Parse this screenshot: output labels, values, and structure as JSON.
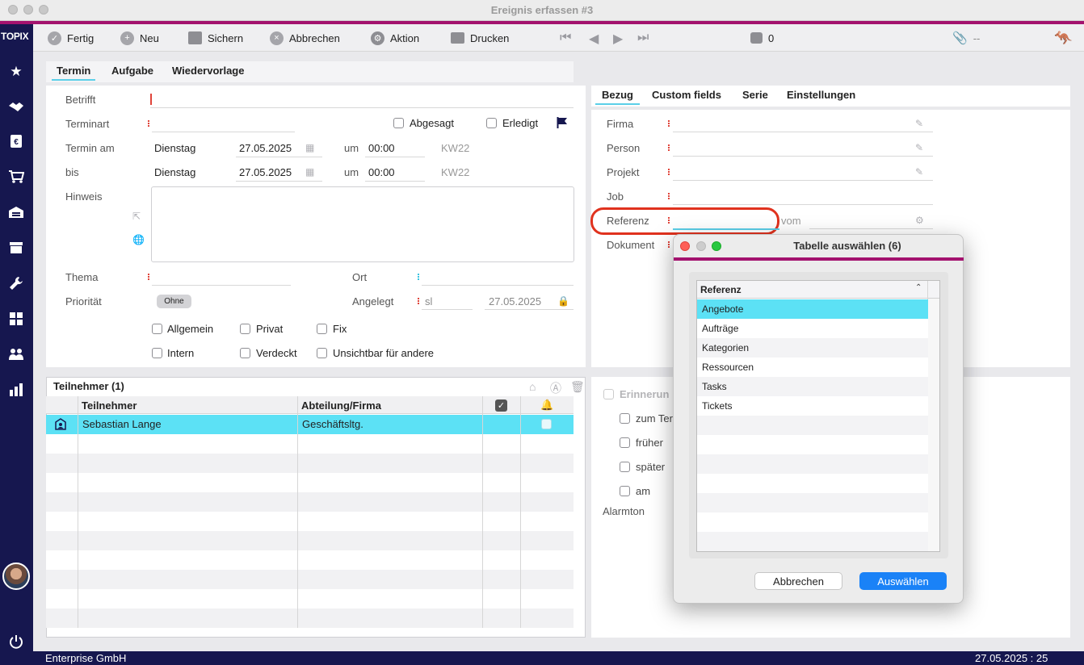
{
  "window": {
    "title": "Ereignis erfassen #3"
  },
  "sidebar": {
    "logo": "TOPIX"
  },
  "toolbar": {
    "fertig": "Fertig",
    "neu": "Neu",
    "sichern": "Sichern",
    "abbrechen": "Abbrechen",
    "aktion": "Aktion",
    "drucken": "Drucken",
    "lock_count": "0",
    "attach": "--"
  },
  "main_tabs": [
    "Termin",
    "Aufgabe",
    "Wiedervorlage"
  ],
  "form": {
    "betrifft_label": "Betrifft",
    "terminart_label": "Terminart",
    "abgesagt": "Abgesagt",
    "erledigt": "Erledigt",
    "termin_am_label": "Termin am",
    "termin_am_day": "Dienstag",
    "termin_am_date": "27.05.2025",
    "um_label": "um",
    "termin_am_time": "00:00",
    "termin_am_kw": "KW22",
    "bis_label": "bis",
    "bis_day": "Dienstag",
    "bis_date": "27.05.2025",
    "bis_um_label": "um",
    "bis_time": "00:00",
    "bis_kw": "KW22",
    "hinweis_label": "Hinweis",
    "thema_label": "Thema",
    "ort_label": "Ort",
    "prioritaet_label": "Priorität",
    "prioritaet_value": "Ohne",
    "angelegt_label": "Angelegt",
    "angelegt_user": "sl",
    "angelegt_date": "27.05.2025",
    "allgemein": "Allgemein",
    "privat": "Privat",
    "fix": "Fix",
    "intern": "Intern",
    "verdeckt": "Verdeckt",
    "unsichtbar": "Unsichtbar für andere"
  },
  "right_tabs": [
    "Bezug",
    "Custom fields",
    "Serie",
    "Einstellungen"
  ],
  "bezug": {
    "firma": "Firma",
    "person": "Person",
    "projekt": "Projekt",
    "job": "Job",
    "referenz": "Referenz",
    "vom": "vom",
    "dokument": "Dokument"
  },
  "participants": {
    "title": "Teilnehmer (1)",
    "col_teilnehmer": "Teilnehmer",
    "col_abteilung": "Abteilung/Firma",
    "rows": [
      {
        "name": "Sebastian Lange",
        "dept": "Geschäftsltg."
      }
    ]
  },
  "reminder": {
    "erinnerung": "Erinnerun",
    "zum_termin": "zum Ter",
    "frueher": "früher",
    "spaeter": "später",
    "am": "am",
    "alarmton": "Alarmton"
  },
  "dialog": {
    "title": "Tabelle auswählen (6)",
    "column": "Referenz",
    "items": [
      "Angebote",
      "Aufträge",
      "Kategorien",
      "Ressourcen",
      "Tasks",
      "Tickets"
    ],
    "cancel": "Abbrechen",
    "ok": "Auswählen",
    "accent": "#1a82f7",
    "selection": "#5ce1f5"
  },
  "status": {
    "company": "Enterprise GmbH",
    "datetime": "27.05.2025 : 25"
  }
}
